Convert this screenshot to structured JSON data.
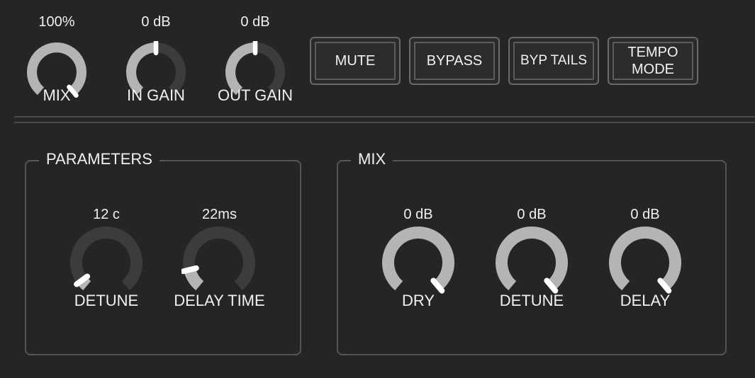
{
  "top": {
    "knobs": [
      {
        "id": "mix",
        "label": "MIX",
        "value": "100%",
        "level": 1.0
      },
      {
        "id": "in-gain",
        "label": "IN GAIN",
        "value": "0 dB",
        "level": 0.5
      },
      {
        "id": "out-gain",
        "label": "OUT GAIN",
        "value": "0 dB",
        "level": 0.5
      }
    ],
    "buttons": {
      "mute": "MUTE",
      "bypass": "BYPASS",
      "byp_tails": "BYP TAILS",
      "tempo_mode_line1": "TEMPO",
      "tempo_mode_line2": "MODE"
    }
  },
  "parameters": {
    "title": "PARAMETERS",
    "knobs": [
      {
        "id": "detune",
        "label": "DETUNE",
        "value": "12 c",
        "level": 0.05
      },
      {
        "id": "delay-time",
        "label": "DELAY TIME",
        "value": "22ms",
        "level": 0.13
      }
    ]
  },
  "mix": {
    "title": "MIX",
    "knobs": [
      {
        "id": "dry",
        "label": "DRY",
        "value": "0 dB",
        "level": 1.0
      },
      {
        "id": "mix-detune",
        "label": "DETUNE",
        "value": "0 dB",
        "level": 1.0
      },
      {
        "id": "delay",
        "label": "DELAY",
        "value": "0 dB",
        "level": 1.0
      }
    ]
  },
  "colors": {
    "background": "#252525",
    "track": "#3c3c3c",
    "fill": "#b4b4b4",
    "indicator": "#ffffff"
  }
}
